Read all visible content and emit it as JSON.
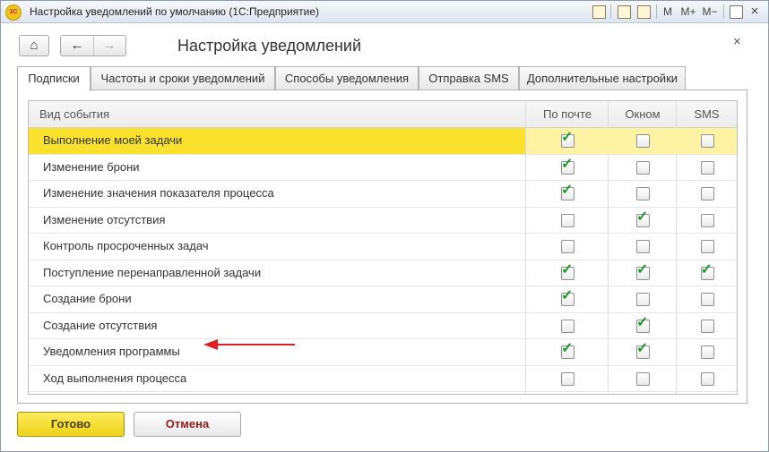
{
  "window": {
    "title": "Настройка уведомлений по умолчанию  (1С:Предприятие)",
    "logo_text": "1С",
    "toolbar": {
      "m": "M",
      "m_plus": "M+",
      "m_minus": "M−"
    }
  },
  "form": {
    "title": "Настройка уведомлений",
    "close_glyph": "×",
    "home_glyph": "⌂",
    "back_glyph": "←",
    "forward_glyph": "→"
  },
  "tabs": [
    {
      "label": "Подписки",
      "active": true
    },
    {
      "label": "Частоты и сроки уведомлений"
    },
    {
      "label": "Способы уведомления"
    },
    {
      "label": "Отправка SMS"
    },
    {
      "label": "Дополнительные настройки"
    }
  ],
  "table": {
    "columns": [
      "Вид события",
      "По почте",
      "Окном",
      "SMS"
    ],
    "rows": [
      {
        "name": "Выполнение моей задачи",
        "email": true,
        "window": false,
        "sms": false,
        "selected": true
      },
      {
        "name": "Изменение брони",
        "email": true,
        "window": false,
        "sms": false
      },
      {
        "name": "Изменение значения показателя процесса",
        "email": true,
        "window": false,
        "sms": false
      },
      {
        "name": "Изменение отсутствия",
        "email": false,
        "window": true,
        "sms": false
      },
      {
        "name": "Контроль просроченных задач",
        "email": false,
        "window": false,
        "sms": false
      },
      {
        "name": "Поступление перенаправленной задачи",
        "email": true,
        "window": true,
        "sms": true
      },
      {
        "name": "Создание брони",
        "email": true,
        "window": false,
        "sms": false
      },
      {
        "name": "Создание отсутствия",
        "email": false,
        "window": true,
        "sms": false
      },
      {
        "name": "Уведомления программы",
        "email": true,
        "window": true,
        "sms": false
      },
      {
        "name": "Ход выполнения процесса",
        "email": false,
        "window": false,
        "sms": false
      }
    ]
  },
  "buttons": {
    "ok": "Готово",
    "cancel": "Отмена"
  },
  "colors": {
    "selected_row": "#f9e12c",
    "check": "#1d9a2a",
    "arrow": "#e02020"
  },
  "check_glyph": "✓"
}
